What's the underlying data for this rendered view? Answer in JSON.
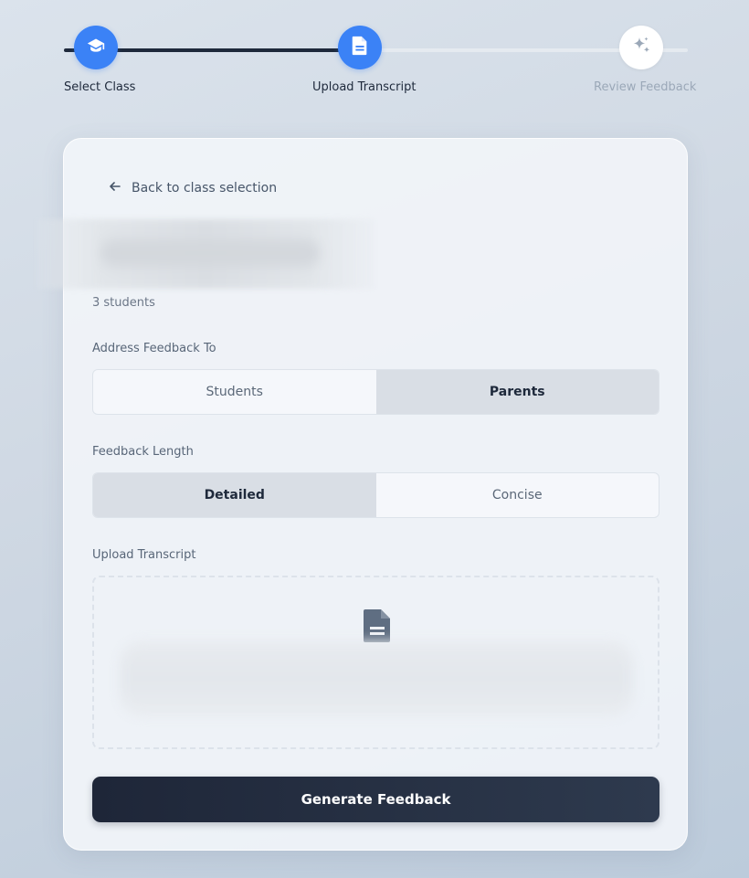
{
  "stepper": {
    "steps": [
      {
        "label": "Select Class",
        "icon": "graduation-cap-icon",
        "state": "completed"
      },
      {
        "label": "Upload Transcript",
        "icon": "document-icon",
        "state": "current"
      },
      {
        "label": "Review Feedback",
        "icon": "sparkles-icon",
        "state": "pending"
      }
    ]
  },
  "card": {
    "back_label": "Back to class selection",
    "student_count": "3 students",
    "address": {
      "label": "Address Feedback To",
      "options": [
        "Students",
        "Parents"
      ],
      "selected": "Parents"
    },
    "length": {
      "label": "Feedback Length",
      "options": [
        "Detailed",
        "Concise"
      ],
      "selected": "Detailed"
    },
    "upload": {
      "label": "Upload Transcript",
      "icon": "document-icon"
    },
    "generate_label": "Generate Feedback"
  },
  "colors": {
    "accent": "#3b82f6",
    "primary_dark": "#1e293b",
    "muted": "#9ba8b8"
  }
}
